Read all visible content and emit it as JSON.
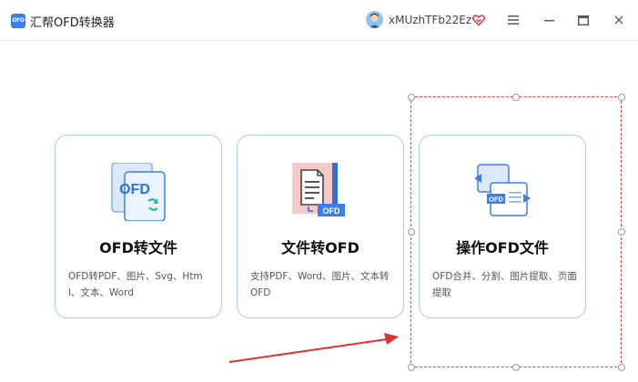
{
  "app": {
    "logo_text": "OFD",
    "title": "汇帮OFD转换器"
  },
  "user": {
    "name": "xMUzhTFb22Ez"
  },
  "icons": {
    "vip": "heart-badge-icon",
    "menu": "hamburger-menu-icon",
    "minimize": "minimize-icon",
    "maximize": "maximize-icon",
    "close": "close-icon"
  },
  "cards": [
    {
      "title": "OFD转文件",
      "desc": "OFD转PDF、图片、Svg、Html、文本、Word",
      "icon_label": "OFD"
    },
    {
      "title": "文件转OFD",
      "desc": "支持PDF、Word、图片、文本转OFD",
      "icon_label": "OFD"
    },
    {
      "title": "操作OFD文件",
      "desc": "OFD合并、分割、图片提取、页面提取",
      "icon_label": "OFD"
    }
  ],
  "colors": {
    "accent": "#3d7fe8",
    "card_border": "#a9cdf6",
    "annotation_red": "#e04646"
  }
}
